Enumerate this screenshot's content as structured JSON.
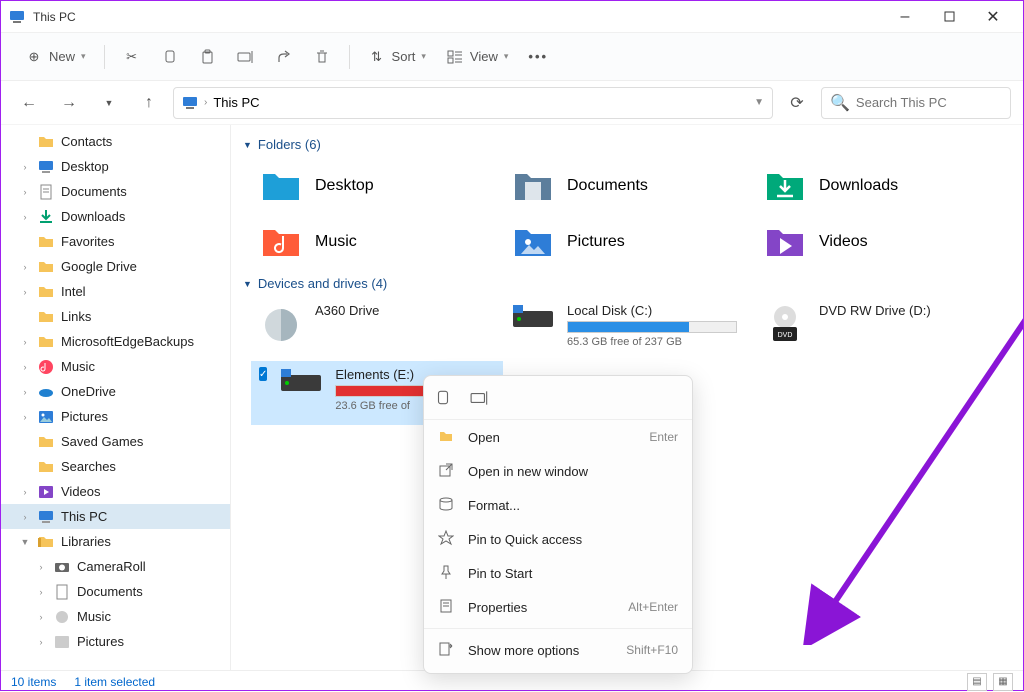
{
  "window": {
    "title": "This PC"
  },
  "toolbar": {
    "new_label": "New",
    "sort_label": "Sort",
    "view_label": "View"
  },
  "address": {
    "location": "This PC",
    "search_placeholder": "Search This PC"
  },
  "sidebar": {
    "items": [
      {
        "label": "Contacts",
        "icon": "folder",
        "exp": false
      },
      {
        "label": "Desktop",
        "icon": "desktop",
        "exp": true
      },
      {
        "label": "Documents",
        "icon": "doc",
        "exp": true
      },
      {
        "label": "Downloads",
        "icon": "download",
        "exp": true
      },
      {
        "label": "Favorites",
        "icon": "folder",
        "exp": false
      },
      {
        "label": "Google Drive",
        "icon": "folder",
        "exp": true
      },
      {
        "label": "Intel",
        "icon": "folder",
        "exp": true
      },
      {
        "label": "Links",
        "icon": "folder",
        "exp": false
      },
      {
        "label": "MicrosoftEdgeBackups",
        "icon": "folder",
        "exp": true
      },
      {
        "label": "Music",
        "icon": "music",
        "exp": true
      },
      {
        "label": "OneDrive",
        "icon": "onedrive",
        "exp": true
      },
      {
        "label": "Pictures",
        "icon": "pictures",
        "exp": true
      },
      {
        "label": "Saved Games",
        "icon": "folder",
        "exp": false
      },
      {
        "label": "Searches",
        "icon": "folder",
        "exp": false
      },
      {
        "label": "Videos",
        "icon": "videos",
        "exp": true
      },
      {
        "label": "This PC",
        "icon": "pc",
        "exp": true,
        "sel": true
      },
      {
        "label": "Libraries",
        "icon": "lib",
        "exp": true,
        "open": true
      },
      {
        "label": "CameraRoll",
        "icon": "camera",
        "exp": true,
        "indent": 1
      },
      {
        "label": "Documents",
        "icon": "doclib",
        "exp": true,
        "indent": 1
      },
      {
        "label": "Music",
        "icon": "musiclib",
        "exp": true,
        "indent": 1
      },
      {
        "label": "Pictures",
        "icon": "piclib",
        "exp": true,
        "indent": 1
      }
    ]
  },
  "groups": {
    "folders": {
      "title": "Folders (6)",
      "items": [
        {
          "label": "Desktop",
          "color": "#1e9fd8"
        },
        {
          "label": "Documents",
          "color": "#5c7e9c"
        },
        {
          "label": "Downloads",
          "color": "#00a97a"
        },
        {
          "label": "Music",
          "color": "#ff5c39"
        },
        {
          "label": "Pictures",
          "color": "#2e7dd7"
        },
        {
          "label": "Videos",
          "color": "#8445c7"
        }
      ]
    },
    "drives": {
      "title": "Devices and drives (4)",
      "items": [
        {
          "label": "A360 Drive",
          "type": "cloud"
        },
        {
          "label": "Local Disk (C:)",
          "type": "disk",
          "bar": 0.72,
          "barcolor": "#2a8fe6",
          "sub": "65.3 GB free of 237 GB"
        },
        {
          "label": "DVD RW Drive (D:)",
          "type": "dvd"
        },
        {
          "label": "Elements (E:)",
          "type": "disk",
          "bar": 0.9,
          "barcolor": "#e23030",
          "sub": "23.6 GB free of",
          "sel": true
        }
      ]
    }
  },
  "context": {
    "items": [
      {
        "label": "Open",
        "icon": "folder-open",
        "shortcut": "Enter"
      },
      {
        "label": "Open in new window",
        "icon": "open-new"
      },
      {
        "label": "Format...",
        "icon": "format"
      },
      {
        "label": "Pin to Quick access",
        "icon": "star"
      },
      {
        "label": "Pin to Start",
        "icon": "pin"
      },
      {
        "label": "Properties",
        "icon": "properties",
        "shortcut": "Alt+Enter"
      },
      {
        "sep": true
      },
      {
        "label": "Show more options",
        "icon": "more",
        "shortcut": "Shift+F10"
      }
    ]
  },
  "status": {
    "count": "10 items",
    "selected": "1 item selected"
  }
}
